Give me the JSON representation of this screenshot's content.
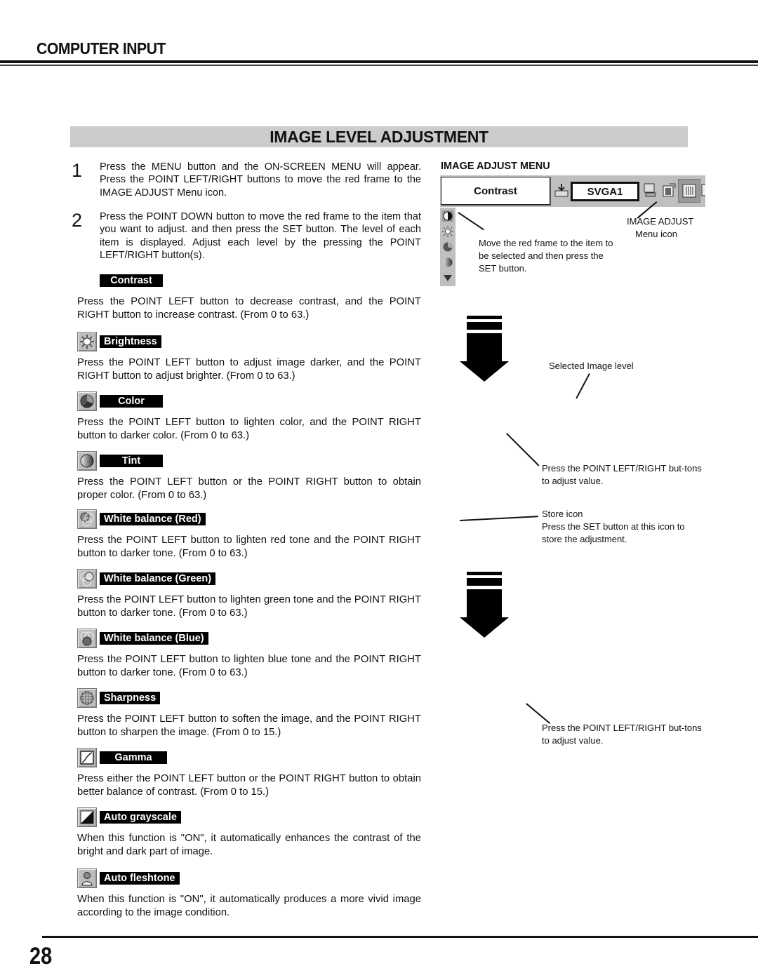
{
  "header": {
    "section_title": "COMPUTER INPUT",
    "page_heading": "IMAGE LEVEL ADJUSTMENT"
  },
  "steps": [
    {
      "number": "1",
      "text": "Press the MENU button and the ON-SCREEN MENU will appear.  Press the POINT LEFT/RIGHT buttons to move the red frame to the IMAGE ADJUST Menu icon."
    },
    {
      "number": "2",
      "text": "Press the POINT DOWN button to move the red frame to the item that you want to adjust. and then press the SET button. The level of each item is displayed.  Adjust each level by the pressing the POINT LEFT/RIGHT button(s)."
    }
  ],
  "items": [
    {
      "label": "Contrast",
      "icon": "none",
      "desc": "Press the POINT LEFT button to decrease contrast, and the POINT RIGHT button to increase contrast.  (From 0 to 63.)"
    },
    {
      "label": "Brightness",
      "icon": "brightness-icon",
      "desc": "Press the POINT LEFT button to adjust image darker, and the POINT RIGHT button to adjust brighter.  (From 0 to 63.)"
    },
    {
      "label": "Color",
      "icon": "color-icon",
      "desc": "Press the POINT LEFT button to lighten color, and the POINT RIGHT button to darker color.  (From 0 to 63.)"
    },
    {
      "label": "Tint",
      "icon": "tint-icon",
      "desc": "Press the POINT LEFT button or the POINT RIGHT button to obtain proper color.  (From 0 to 63.)"
    },
    {
      "label": "White balance (Red)",
      "icon": "white-balance-red-icon",
      "desc": "Press the POINT LEFT button to lighten red tone and the POINT RIGHT button to darker tone.  (From 0 to 63.)"
    },
    {
      "label": "White balance (Green)",
      "icon": "white-balance-green-icon",
      "desc": "Press the POINT LEFT button to lighten green tone and the POINT RIGHT button to darker tone.  (From 0 to 63.)"
    },
    {
      "label": "White balance (Blue)",
      "icon": "white-balance-blue-icon",
      "desc": "Press the POINT LEFT button to lighten blue tone and the POINT RIGHT button to darker tone.  (From 0 to 63.)"
    },
    {
      "label": "Sharpness",
      "icon": "sharpness-icon",
      "desc": "Press the POINT LEFT button to soften the image, and the POINT RIGHT button to sharpen the image.  (From 0 to 15.)"
    },
    {
      "label": "Gamma",
      "icon": "gamma-icon",
      "desc": "Press either the POINT LEFT button or the POINT RIGHT button to obtain better balance of contrast.  (From 0 to 15.)"
    },
    {
      "label": "Auto grayscale",
      "icon": "auto-grayscale-icon",
      "desc": "When this function is \"ON\", it automatically enhances the contrast of the bright and dark part of image."
    },
    {
      "label": "Auto fleshtone",
      "icon": "auto-fleshtone-icon",
      "desc": "When this function is \"ON\", it automatically produces a more vivid image according to the image condition."
    }
  ],
  "image_adjust_menu": {
    "title": "IMAGE ADJUST MENU",
    "selected_item": "Contrast",
    "source": "SVGA1",
    "menu_icon_note": [
      "IMAGE ADJUST",
      "Menu icon"
    ],
    "move_note": "Move the red frame to the item to be selected and then press the SET button."
  },
  "annotations": {
    "selected_level": "Selected Image level",
    "adjust_value_1": "Press the POINT LEFT/RIGHT but-tons to adjust value.",
    "store_icon_title": "Store icon",
    "store_icon_desc": "Press the SET button at this icon to store the adjustment.",
    "adjust_value_2": "Press the POINT LEFT/RIGHT but-tons to adjust value."
  },
  "footer": {
    "page_number": "28"
  }
}
